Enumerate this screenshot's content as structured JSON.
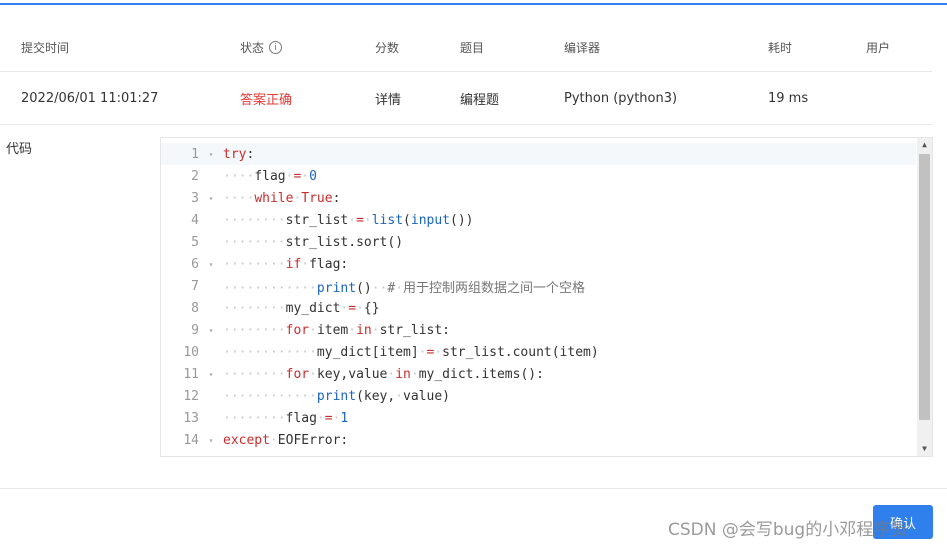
{
  "table": {
    "headers": {
      "submit_time": "提交时间",
      "status": "状态",
      "score": "分数",
      "problem": "题目",
      "compiler": "编译器",
      "time_cost": "耗时",
      "user": "用户"
    },
    "row": {
      "submit_time": "2022/06/01 11:01:27",
      "status": "答案正确",
      "score": "详情",
      "problem": "编程题",
      "compiler": "Python (python3)",
      "time_cost": "19 ms",
      "user": ""
    }
  },
  "code_section": {
    "label": "代码",
    "line_numbers": [
      "1",
      "2",
      "3",
      "4",
      "5",
      "6",
      "7",
      "8",
      "9",
      "10",
      "11",
      "12",
      "13",
      "14"
    ],
    "fold_markers": [
      "▾",
      "",
      "▾",
      "",
      "",
      "▾",
      "",
      "",
      "▾",
      "",
      "▾",
      "",
      "",
      "▾"
    ],
    "lines": [
      "try:",
      "····flag·=·0",
      "····while·True:",
      "········str_list·=·list(input())",
      "········str_list.sort()",
      "········if·flag:",
      "············print()··#·用于控制两组数据之间一个空格",
      "········my_dict·=·{}",
      "········for·item·in·str_list:",
      "············my_dict[item]·=·str_list.count(item)",
      "········for·key,value·in·my_dict.items():",
      "············print(key,·value)",
      "········flag·=·1",
      "except·EOFError:"
    ]
  },
  "footer": {
    "confirm_label": "确认",
    "watermark": "CSDN @会写bug的小邓程序员"
  },
  "colors": {
    "accent": "#2f80ed",
    "status_correct": "#e53935",
    "keyword": "#c92c2c",
    "builtin": "#1a64c2"
  }
}
